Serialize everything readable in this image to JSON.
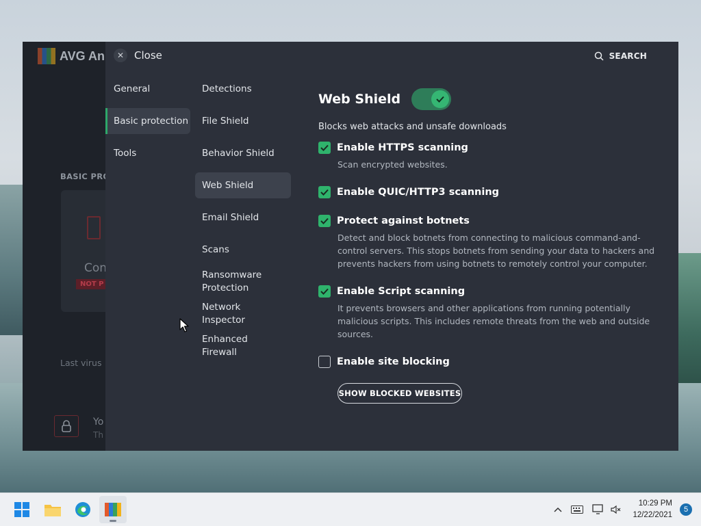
{
  "background_app": {
    "logo_text": "AVG An",
    "section_label": "BASIC PRO",
    "card_title": "Con",
    "card_badge": "NOT P",
    "last_scan": "Last virus",
    "bottom_title": "Yo",
    "bottom_sub": "Th"
  },
  "settings": {
    "close_label": "Close",
    "search_label": "SEARCH",
    "categories": [
      {
        "label": "General",
        "active": false
      },
      {
        "label": "Basic protection",
        "active": true
      },
      {
        "label": "Tools",
        "active": false
      }
    ],
    "subcategories": [
      {
        "label": "Detections",
        "active": false
      },
      {
        "label": "File Shield",
        "active": false
      },
      {
        "label": "Behavior Shield",
        "active": false
      },
      {
        "label": "Web Shield",
        "active": true
      },
      {
        "label": "Email Shield",
        "active": false
      },
      {
        "label": "Scans",
        "active": false
      },
      {
        "label": "Ransomware Protection",
        "active": false
      },
      {
        "label": "Network Inspector",
        "active": false
      },
      {
        "label": "Enhanced Firewall",
        "active": false
      }
    ]
  },
  "web_shield": {
    "title": "Web Shield",
    "enabled": true,
    "description": "Blocks web attacks and unsafe downloads",
    "options": [
      {
        "label": "Enable HTTPS scanning",
        "checked": true,
        "description": "Scan encrypted websites."
      },
      {
        "label": "Enable QUIC/HTTP3 scanning",
        "checked": true,
        "description": ""
      },
      {
        "label": "Protect against botnets",
        "checked": true,
        "description": "Detect and block botnets from connecting to malicious command-and-control servers. This stops botnets from sending your data to hackers and prevents hackers from using botnets to remotely control your computer."
      },
      {
        "label": "Enable Script scanning",
        "checked": true,
        "description": "It prevents browsers and other applications from running potentially malicious scripts. This includes remote threats from the web and outside sources."
      },
      {
        "label": "Enable site blocking",
        "checked": false,
        "description": ""
      }
    ],
    "blocked_button": "SHOW BLOCKED WEBSITES"
  },
  "colors": {
    "accent_green": "#2fb36c",
    "panel_bg": "#2c303a",
    "window_bg": "#1f232a"
  },
  "taskbar": {
    "apps": [
      {
        "name": "start-icon"
      },
      {
        "name": "file-explorer-icon"
      },
      {
        "name": "edge-icon"
      },
      {
        "name": "avg-icon",
        "active": true
      }
    ],
    "time": "10:29 PM",
    "date": "12/22/2021",
    "notification_count": "5"
  }
}
